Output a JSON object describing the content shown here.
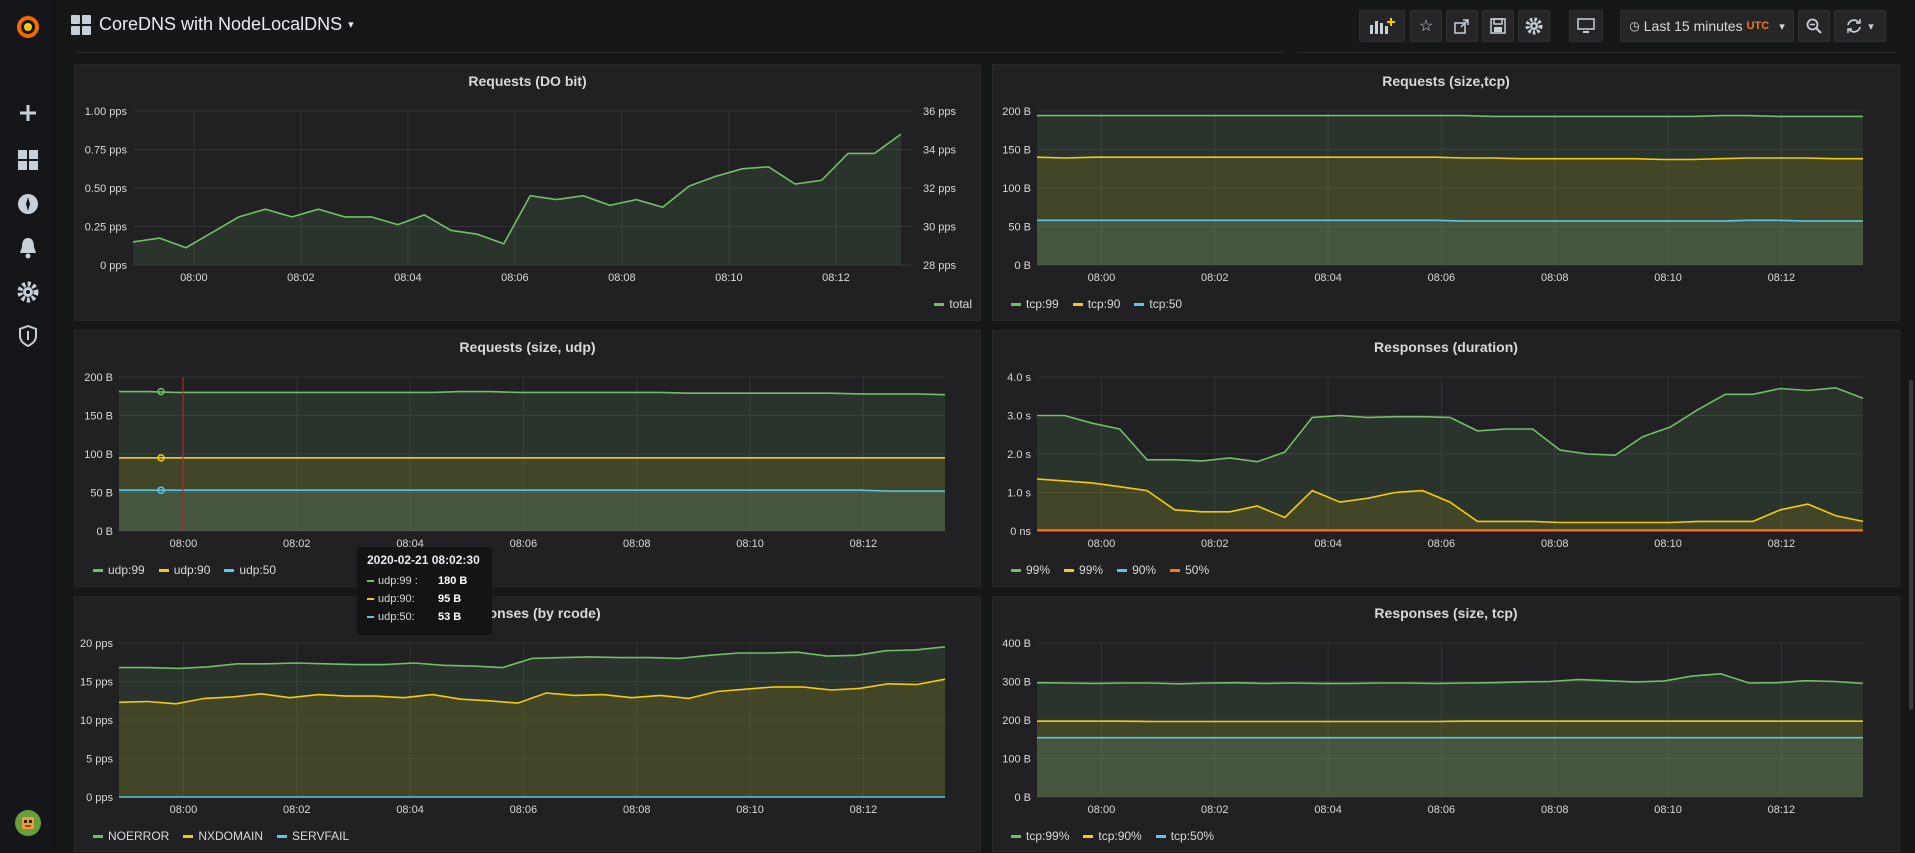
{
  "navbar": {
    "dashboard_title": "CoreDNS with NodeLocalDNS",
    "time_range": "Last 15 minutes",
    "timezone": "UTC"
  },
  "sidemenu": {
    "items": [
      "create",
      "dashboards",
      "explore",
      "alerting",
      "configuration",
      "server-admin"
    ]
  },
  "tooltip": {
    "time": "2020-02-21 08:02:30",
    "rows": [
      {
        "name": "udp:99 :",
        "value": "180 B",
        "color": "#73bf69"
      },
      {
        "name": "udp:90:",
        "value": "95 B",
        "color": "#f2cc0c"
      },
      {
        "name": "udp:50:",
        "value": "53 B",
        "color": "#5ac6e8"
      }
    ]
  },
  "panels": [
    {
      "title": "Requests (DO bit)",
      "legend": [
        {
          "name": "total",
          "color": "#73bf69"
        }
      ]
    },
    {
      "title": "Requests (size,tcp)",
      "legend": [
        {
          "name": "tcp:99",
          "color": "#73bf69"
        },
        {
          "name": "tcp:90",
          "color": "#f2cc0c"
        },
        {
          "name": "tcp:50",
          "color": "#5ac6e8"
        }
      ]
    },
    {
      "title": "Requests (size, udp)",
      "legend": [
        {
          "name": "udp:99",
          "color": "#73bf69"
        },
        {
          "name": "udp:90",
          "color": "#f2cc0c"
        },
        {
          "name": "udp:50",
          "color": "#5ac6e8"
        }
      ]
    },
    {
      "title": "Responses (duration)",
      "legend": [
        {
          "name": "99%",
          "color": "#73bf69"
        },
        {
          "name": "99%",
          "color": "#f2cc0c"
        },
        {
          "name": "90%",
          "color": "#5ac6e8"
        },
        {
          "name": "50%",
          "color": "#ff780a"
        }
      ]
    },
    {
      "title": "Responses (by rcode)",
      "legend": [
        {
          "name": "NOERROR",
          "color": "#73bf69"
        },
        {
          "name": "NXDOMAIN",
          "color": "#f2cc0c"
        },
        {
          "name": "SERVFAIL",
          "color": "#5ac6e8"
        }
      ]
    },
    {
      "title": "Responses (size, tcp)",
      "legend": [
        {
          "name": "tcp:99%",
          "color": "#73bf69"
        },
        {
          "name": "tcp:90%",
          "color": "#f2cc0c"
        },
        {
          "name": "tcp:50%",
          "color": "#5ac6e8"
        }
      ]
    }
  ],
  "chart_data": [
    {
      "type": "line",
      "title": "Requests (DO bit)",
      "x": [
        "07:59:00",
        "07:59:30",
        "08:00:00",
        "08:00:30",
        "08:01:00",
        "08:01:30",
        "08:02:00",
        "08:02:30",
        "08:03:00",
        "08:03:30",
        "08:04:00",
        "08:04:30",
        "08:05:00",
        "08:05:30",
        "08:06:00",
        "08:06:30",
        "08:07:00",
        "08:07:30",
        "08:08:00",
        "08:08:30",
        "08:09:00",
        "08:09:30",
        "08:10:00",
        "08:10:30",
        "08:11:00",
        "08:11:30",
        "08:12:00",
        "08:12:30",
        "08:13:00",
        "08:13:30"
      ],
      "xticks": [
        "08:00",
        "08:02",
        "08:04",
        "08:06",
        "08:08",
        "08:10",
        "08:12"
      ],
      "yticks": [
        "0 pps",
        "0.25 pps",
        "0.50 pps",
        "0.75 pps",
        "1.00 pps"
      ],
      "y2ticks": [
        "28 pps",
        "30 pps",
        "32 pps",
        "34 pps",
        "36 pps"
      ],
      "ylim": [
        0,
        1.0
      ],
      "y2lim": [
        28,
        36
      ],
      "series": [
        {
          "name": "total",
          "color": "#73bf69",
          "axis": "right",
          "values": [
            29.2,
            29.4,
            28.9,
            29.7,
            30.5,
            30.9,
            30.5,
            30.9,
            30.5,
            30.5,
            30.1,
            30.6,
            29.8,
            29.6,
            29.1,
            31.6,
            31.4,
            31.6,
            31.1,
            31.4,
            31.0,
            32.1,
            32.6,
            33.0,
            33.1,
            32.2,
            32.4,
            33.8,
            33.8,
            34.8
          ]
        }
      ]
    },
    {
      "type": "area",
      "title": "Requests (size,tcp)",
      "xticks": [
        "08:00",
        "08:02",
        "08:04",
        "08:06",
        "08:08",
        "08:10",
        "08:12"
      ],
      "yticks": [
        "0 B",
        "50 B",
        "100 B",
        "150 B",
        "200 B"
      ],
      "ylim": [
        0,
        200
      ],
      "series": [
        {
          "name": "tcp:99",
          "color": "#73bf69",
          "values": [
            194,
            194,
            194,
            194,
            194,
            194,
            194,
            194,
            194,
            194,
            194,
            194,
            194,
            194,
            194,
            194,
            193,
            193,
            193,
            193,
            193,
            193,
            193,
            193,
            194,
            194,
            193,
            193,
            193,
            193
          ]
        },
        {
          "name": "tcp:90",
          "color": "#f2cc0c",
          "values": [
            140,
            139,
            140,
            140,
            140,
            140,
            140,
            140,
            140,
            140,
            140,
            140,
            140,
            140,
            140,
            139,
            139,
            138,
            138,
            138,
            138,
            138,
            137,
            137,
            138,
            139,
            139,
            139,
            138,
            138
          ]
        },
        {
          "name": "tcp:50",
          "color": "#5ac6e8",
          "values": [
            58,
            58,
            58,
            58,
            58,
            58,
            58,
            58,
            58,
            58,
            58,
            58,
            58,
            58,
            58,
            57,
            57,
            57,
            57,
            57,
            57,
            57,
            57,
            57,
            57,
            58,
            58,
            57,
            57,
            57
          ]
        }
      ]
    },
    {
      "type": "area",
      "title": "Requests (size, udp)",
      "xticks": [
        "08:00",
        "08:02",
        "08:04",
        "08:06",
        "08:08",
        "08:10",
        "08:12"
      ],
      "yticks": [
        "0 B",
        "50 B",
        "100 B",
        "150 B",
        "200 B"
      ],
      "ylim": [
        0,
        200
      ],
      "series": [
        {
          "name": "udp:99",
          "color": "#73bf69",
          "values": [
            181,
            181,
            180,
            180,
            180,
            180,
            180,
            180,
            180,
            180,
            180,
            180,
            181,
            181,
            180,
            180,
            180,
            180,
            180,
            180,
            179,
            179,
            179,
            179,
            179,
            179,
            178,
            178,
            178,
            177
          ]
        },
        {
          "name": "udp:90",
          "color": "#f2cc0c",
          "values": [
            95,
            95,
            95,
            95,
            95,
            95,
            95,
            95,
            95,
            95,
            95,
            95,
            95,
            95,
            95,
            95,
            95,
            95,
            95,
            95,
            95,
            95,
            95,
            95,
            95,
            95,
            95,
            95,
            95,
            95
          ]
        },
        {
          "name": "udp:50",
          "color": "#5ac6e8",
          "values": [
            53,
            53,
            53,
            53,
            53,
            53,
            53,
            53,
            53,
            53,
            53,
            53,
            53,
            53,
            53,
            53,
            53,
            53,
            53,
            53,
            53,
            53,
            53,
            53,
            53,
            53,
            53,
            52,
            52,
            52
          ]
        }
      ]
    },
    {
      "type": "area",
      "title": "Responses (duration)",
      "xticks": [
        "08:00",
        "08:02",
        "08:04",
        "08:06",
        "08:08",
        "08:10",
        "08:12"
      ],
      "yticks": [
        "0 ns",
        "1.0 s",
        "2.0 s",
        "3.0 s",
        "4.0 s"
      ],
      "ylim": [
        0,
        4.0
      ],
      "series": [
        {
          "name": "99%",
          "color": "#73bf69",
          "values": [
            3.0,
            3.0,
            2.8,
            2.65,
            1.85,
            1.85,
            1.82,
            1.9,
            1.8,
            2.05,
            2.95,
            3.0,
            2.95,
            2.97,
            2.97,
            2.95,
            2.6,
            2.65,
            2.65,
            2.1,
            2.0,
            1.97,
            2.45,
            2.7,
            3.15,
            3.55,
            3.55,
            3.7,
            3.65,
            3.72,
            3.45
          ]
        },
        {
          "name": "99%",
          "color": "#f2cc0c",
          "values": [
            1.35,
            1.3,
            1.25,
            1.15,
            1.05,
            0.55,
            0.5,
            0.5,
            0.65,
            0.35,
            1.05,
            0.75,
            0.85,
            1.0,
            1.05,
            0.75,
            0.25,
            0.25,
            0.25,
            0.22,
            0.22,
            0.22,
            0.22,
            0.22,
            0.25,
            0.25,
            0.25,
            0.55,
            0.7,
            0.4,
            0.25
          ]
        },
        {
          "name": "90%",
          "color": "#5ac6e8",
          "values": [
            0.02,
            0.02,
            0.02,
            0.02,
            0.02,
            0.02,
            0.02,
            0.02,
            0.02,
            0.02,
            0.02,
            0.02,
            0.02,
            0.02,
            0.02,
            0.02,
            0.02,
            0.02,
            0.02,
            0.02,
            0.02,
            0.02,
            0.02,
            0.02,
            0.02,
            0.02,
            0.02,
            0.02,
            0.02,
            0.02,
            0.02
          ]
        },
        {
          "name": "50%",
          "color": "#ff780a",
          "values": [
            0.01,
            0.01,
            0.01,
            0.01,
            0.01,
            0.01,
            0.01,
            0.01,
            0.01,
            0.01,
            0.01,
            0.01,
            0.01,
            0.01,
            0.01,
            0.01,
            0.01,
            0.01,
            0.01,
            0.01,
            0.01,
            0.01,
            0.01,
            0.01,
            0.01,
            0.01,
            0.01,
            0.01,
            0.01,
            0.01,
            0.01
          ]
        }
      ]
    },
    {
      "type": "area",
      "title": "Responses (by rcode)",
      "xticks": [
        "08:00",
        "08:02",
        "08:04",
        "08:06",
        "08:08",
        "08:10",
        "08:12"
      ],
      "yticks": [
        "0 pps",
        "5 pps",
        "10 pps",
        "15 pps",
        "20 pps"
      ],
      "ylim": [
        0,
        20
      ],
      "series": [
        {
          "name": "NOERROR",
          "color": "#73bf69",
          "values": [
            16.8,
            16.8,
            16.7,
            16.9,
            17.3,
            17.3,
            17.4,
            17.3,
            17.2,
            17.2,
            17.4,
            17.1,
            17.0,
            16.8,
            18.0,
            18.1,
            18.2,
            18.1,
            18.1,
            18.0,
            18.4,
            18.7,
            18.7,
            18.8,
            18.3,
            18.4,
            19.0,
            19.1,
            19.5
          ]
        },
        {
          "name": "NXDOMAIN",
          "color": "#f2cc0c",
          "values": [
            12.3,
            12.4,
            12.1,
            12.8,
            13.0,
            13.4,
            12.9,
            13.3,
            13.1,
            13.1,
            12.9,
            13.3,
            12.7,
            12.5,
            12.2,
            13.5,
            13.2,
            13.3,
            12.9,
            13.2,
            12.8,
            13.7,
            14.0,
            14.3,
            14.3,
            13.9,
            14.1,
            14.7,
            14.6,
            15.3
          ]
        },
        {
          "name": "SERVFAIL",
          "color": "#5ac6e8",
          "values": [
            0,
            0,
            0,
            0,
            0,
            0,
            0,
            0,
            0,
            0,
            0,
            0,
            0,
            0,
            0,
            0,
            0,
            0,
            0,
            0,
            0,
            0,
            0,
            0,
            0,
            0,
            0,
            0,
            0
          ]
        }
      ]
    },
    {
      "type": "area",
      "title": "Responses (size, tcp)",
      "xticks": [
        "08:00",
        "08:02",
        "08:04",
        "08:06",
        "08:08",
        "08:10",
        "08:12"
      ],
      "yticks": [
        "0 B",
        "100 B",
        "200 B",
        "300 B",
        "400 B"
      ],
      "ylim": [
        0,
        400
      ],
      "series": [
        {
          "name": "tcp:99%",
          "color": "#73bf69",
          "values": [
            297,
            296,
            295,
            296,
            296,
            294,
            296,
            297,
            295,
            296,
            295,
            295,
            296,
            296,
            295,
            296,
            297,
            299,
            300,
            305,
            302,
            299,
            301,
            314,
            320,
            296,
            297,
            302,
            300,
            295
          ]
        },
        {
          "name": "tcp:90%",
          "color": "#f2cc0c",
          "values": [
            197,
            197,
            197,
            197,
            196,
            196,
            196,
            196,
            196,
            196,
            196,
            196,
            196,
            196,
            196,
            197,
            197,
            197,
            197,
            197,
            197,
            197,
            197,
            197,
            197,
            197,
            197,
            197,
            197,
            197
          ]
        },
        {
          "name": "tcp:50%",
          "color": "#5ac6e8",
          "values": [
            154,
            154,
            154,
            154,
            154,
            154,
            154,
            154,
            154,
            154,
            154,
            154,
            154,
            154,
            154,
            154,
            154,
            154,
            154,
            154,
            154,
            154,
            154,
            154,
            154,
            154,
            154,
            154,
            154,
            154
          ]
        }
      ]
    }
  ]
}
